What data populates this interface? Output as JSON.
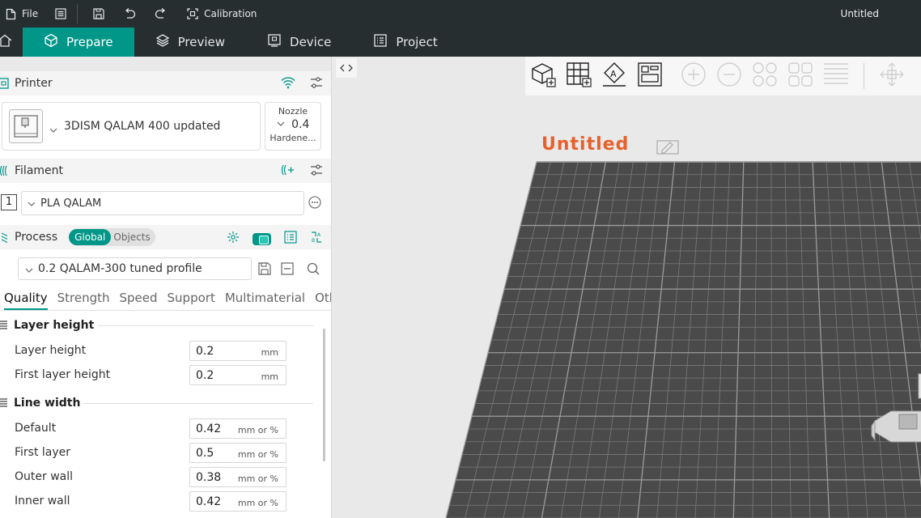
{
  "titlebar": {
    "file_label": "File",
    "calibration_label": "Calibration",
    "document_title": "Untitled"
  },
  "tabs": [
    {
      "label": "Prepare"
    },
    {
      "label": "Preview"
    },
    {
      "label": "Device"
    },
    {
      "label": "Project"
    }
  ],
  "printer": {
    "section_title": "Printer",
    "name": "3DISM QALAM 400 updated",
    "nozzle_title": "Nozzle",
    "nozzle_size": "0.4",
    "nozzle_type": "Hardene..."
  },
  "filament": {
    "section_title": "Filament",
    "slot": "1",
    "name": "PLA QALAM"
  },
  "process": {
    "section_title": "Process",
    "toggle_global": "Global",
    "toggle_objects": "Objects",
    "profile": "0.2 QALAM-300 tuned profile"
  },
  "subtabs": [
    "Quality",
    "Strength",
    "Speed",
    "Support",
    "Multimaterial",
    "Oth..."
  ],
  "groups": {
    "layer_height": {
      "title": "Layer height",
      "params": [
        {
          "label": "Layer height",
          "value": "0.2",
          "unit": "mm"
        },
        {
          "label": "First layer height",
          "value": "0.2",
          "unit": "mm"
        }
      ]
    },
    "line_width": {
      "title": "Line width",
      "params": [
        {
          "label": "Default",
          "value": "0.42",
          "unit": "mm or %"
        },
        {
          "label": "First layer",
          "value": "0.5",
          "unit": "mm or %"
        },
        {
          "label": "Outer wall",
          "value": "0.38",
          "unit": "mm or %"
        },
        {
          "label": "Inner wall",
          "value": "0.42",
          "unit": "mm or %"
        }
      ]
    }
  },
  "viewport": {
    "plate_name": "Untitled"
  },
  "colors": {
    "accent": "#009688",
    "titlebar_bg": "#262e30",
    "plate_grid": "#4a4a4a",
    "plate_label": "#e8612c"
  },
  "icons": [
    "file-icon",
    "menu-icon",
    "save-icon",
    "undo-icon",
    "redo-icon",
    "calibration-icon",
    "home-icon",
    "cube-icon",
    "layers-icon",
    "device-icon",
    "project-icon",
    "wifi-icon",
    "settings-icon",
    "add-filament-icon",
    "more-icon",
    "process-icon",
    "compare-icon",
    "search-icon",
    "collapse-icon",
    "add-cube-icon",
    "grid-icon",
    "auto-orient-icon",
    "arrange-icon",
    "zoom-in-icon",
    "zoom-out-icon",
    "split-icon",
    "layout-icon",
    "stack-icon",
    "move-icon",
    "edit-icon"
  ]
}
